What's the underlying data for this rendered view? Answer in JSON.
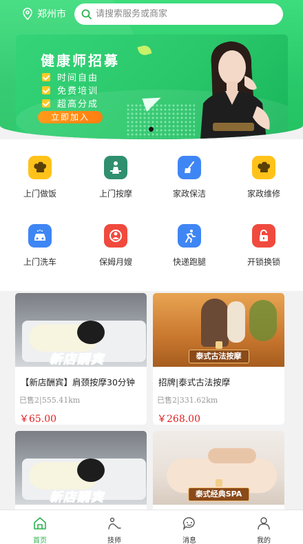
{
  "header": {
    "city": "郑州市",
    "search_placeholder": "请搜索服务或商家"
  },
  "banner": {
    "title": "健康师招募",
    "features": [
      "时间自由",
      "免费培训",
      "超高分成"
    ],
    "cta": "立即加入"
  },
  "categories": [
    {
      "label": "上门做饭",
      "icon": "chef-hat-icon",
      "color": "#ffc21a"
    },
    {
      "label": "上门按摩",
      "icon": "massage-icon",
      "color": "#2f8f6f"
    },
    {
      "label": "家政保洁",
      "icon": "broom-icon",
      "color": "#3f86f5"
    },
    {
      "label": "家政维修",
      "icon": "chef-hat-icon",
      "color": "#ffc21a"
    },
    {
      "label": "上门洗车",
      "icon": "car-icon",
      "color": "#3f86f5"
    },
    {
      "label": "保姆月嫂",
      "icon": "nanny-icon",
      "color": "#f04a3e"
    },
    {
      "label": "快递跑腿",
      "icon": "runner-icon",
      "color": "#3f86f5"
    },
    {
      "label": "开锁换锁",
      "icon": "lock-icon",
      "color": "#f04a3e"
    }
  ],
  "products": [
    {
      "name": "【新店酬宾】肩颈按摩30分钟",
      "sold": "已售2",
      "distance": "555.41km",
      "price": "￥65.00",
      "image_text": "新店酬宾"
    },
    {
      "name": "招牌|泰式古法按摩",
      "sold": "已售2",
      "distance": "331.62km",
      "price": "￥268.00",
      "image_text": "泰式古法按摩"
    },
    {
      "name": "",
      "image_text": "新店酬宾"
    },
    {
      "name": "",
      "image_text": "泰式经典SPA"
    }
  ],
  "tabbar": [
    {
      "label": "首页",
      "icon": "home-icon",
      "active": true
    },
    {
      "label": "技师",
      "icon": "technician-icon",
      "active": false
    },
    {
      "label": "消息",
      "icon": "message-icon",
      "active": false
    },
    {
      "label": "我的",
      "icon": "profile-icon",
      "active": false
    }
  ],
  "colors": {
    "brand_green": "#28c96a",
    "price_red": "#e02020",
    "cta_orange": "#ff8a17"
  }
}
